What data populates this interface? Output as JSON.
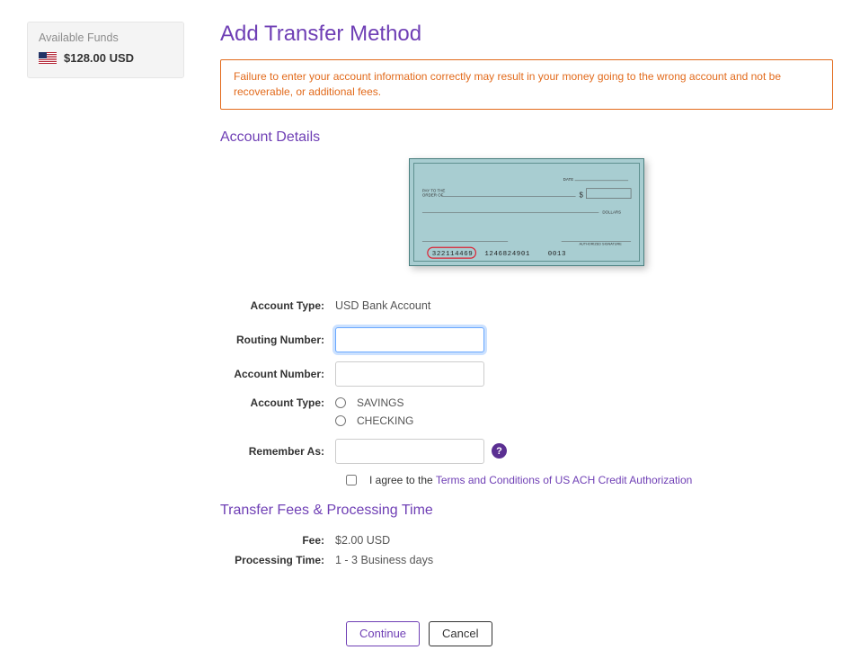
{
  "sidebar": {
    "funds_title": "Available Funds",
    "funds_amount": "$128.00 USD"
  },
  "page": {
    "title": "Add Transfer Method",
    "alert": "Failure to enter your account information correctly may result in your money going to the wrong account and not be recoverable, or additional fees."
  },
  "sections": {
    "account_details": "Account Details",
    "fees": "Transfer Fees & Processing Time"
  },
  "check": {
    "pay_to": "PAY TO THE",
    "order_of": "ORDER OF",
    "date_label": "DATE",
    "dollars_label": "DOLLARS",
    "sig_label": "AUTHORIZED SIGNATURE",
    "dollar_sign": "$",
    "micr_routing": "322114469",
    "micr_account": "1246824901",
    "micr_check": "0013"
  },
  "form": {
    "account_type_label": "Account Type:",
    "account_type_value": "USD Bank Account",
    "routing_label": "Routing Number:",
    "routing_value": "",
    "account_number_label": "Account Number:",
    "account_number_value": "",
    "account_type2_label": "Account Type:",
    "radio_savings": "SAVINGS",
    "radio_checking": "CHECKING",
    "remember_label": "Remember As:",
    "remember_value": "",
    "help_symbol": "?",
    "agree_prefix": "I agree to the ",
    "agree_link": "Terms and Conditions of US ACH Credit Authorization"
  },
  "fees": {
    "fee_label": "Fee:",
    "fee_value": "$2.00 USD",
    "processing_label": "Processing Time:",
    "processing_value": "1 - 3 Business days"
  },
  "buttons": {
    "continue": "Continue",
    "cancel": "Cancel"
  }
}
